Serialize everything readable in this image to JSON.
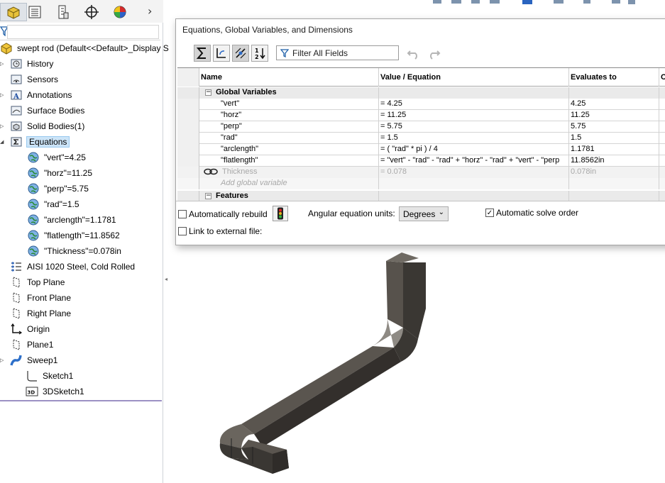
{
  "tree": {
    "root_label": "swept rod  (Default<<Default>_Display S",
    "items": [
      {
        "label": "History",
        "icon": "history-folder-icon"
      },
      {
        "label": "Sensors",
        "icon": "sensors-folder-icon"
      },
      {
        "label": "Annotations",
        "icon": "annotations-folder-icon"
      },
      {
        "label": "Surface Bodies",
        "icon": "surface-bodies-folder-icon"
      },
      {
        "label": "Solid Bodies(1)",
        "icon": "solid-bodies-folder-icon"
      },
      {
        "label": "Equations",
        "icon": "equations-folder-icon"
      },
      {
        "label": "\"vert\"=4.25",
        "icon": "global-variable-icon"
      },
      {
        "label": "\"horz\"=11.25",
        "icon": "global-variable-icon"
      },
      {
        "label": "\"perp\"=5.75",
        "icon": "global-variable-icon"
      },
      {
        "label": "\"rad\"=1.5",
        "icon": "global-variable-icon"
      },
      {
        "label": "\"arclength\"=1.1781",
        "icon": "global-variable-icon"
      },
      {
        "label": "\"flatlength\"=11.8562",
        "icon": "global-variable-icon"
      },
      {
        "label": "\"Thickness\"=0.078in",
        "icon": "global-variable-icon"
      },
      {
        "label": "AISI 1020 Steel, Cold Rolled",
        "icon": "material-icon"
      },
      {
        "label": "Top Plane",
        "icon": "plane-icon"
      },
      {
        "label": "Front Plane",
        "icon": "plane-icon"
      },
      {
        "label": "Right Plane",
        "icon": "plane-icon"
      },
      {
        "label": "Origin",
        "icon": "origin-icon"
      },
      {
        "label": "Plane1",
        "icon": "plane-icon"
      },
      {
        "label": "Sweep1",
        "icon": "sweep-icon"
      },
      {
        "label": "Sketch1",
        "icon": "sketch-icon"
      },
      {
        "label": "3DSketch1",
        "icon": "3d-sketch-icon"
      }
    ]
  },
  "dialog": {
    "title": "Equations, Global Variables, and Dimensions",
    "filter_placeholder": "Filter All Fields",
    "columns": [
      "Name",
      "Value / Equation",
      "Evaluates to",
      "C"
    ],
    "section_global": "Global Variables",
    "rows": [
      {
        "name": "\"vert\"",
        "value": "= 4.25",
        "evaluates": "4.25"
      },
      {
        "name": "\"horz\"",
        "value": "= 11.25",
        "evaluates": "11.25"
      },
      {
        "name": "\"perp\"",
        "value": "= 5.75",
        "evaluates": "5.75"
      },
      {
        "name": "\"rad\"",
        "value": "= 1.5",
        "evaluates": "1.5"
      },
      {
        "name": "\"arclength\"",
        "value": "= ( \"rad\" * pi ) / 4",
        "evaluates": "1.1781"
      },
      {
        "name": "\"flatlength\"",
        "value": "= \"vert\" - \"rad\" - \"rad\" + \"horz\" - \"rad\" + \"vert\" - \"perp",
        "evaluates": "11.8562in"
      }
    ],
    "thickness_row": {
      "name": "Thickness",
      "value": "= 0.078",
      "evaluates": "0.078in"
    },
    "add_global_placeholder": "Add global variable",
    "section_features": "Features",
    "auto_rebuild_label": "Automatically rebuild",
    "angular_units_label": "Angular equation units:",
    "angular_units_value": "Degrees",
    "auto_solve_label": "Automatic solve order",
    "link_external_label": "Link to external file:"
  },
  "colors": {
    "selection": "#cce4f7",
    "part_dark": "#3b3834",
    "part_mid": "#57524c",
    "part_light": "#8e8a84"
  }
}
